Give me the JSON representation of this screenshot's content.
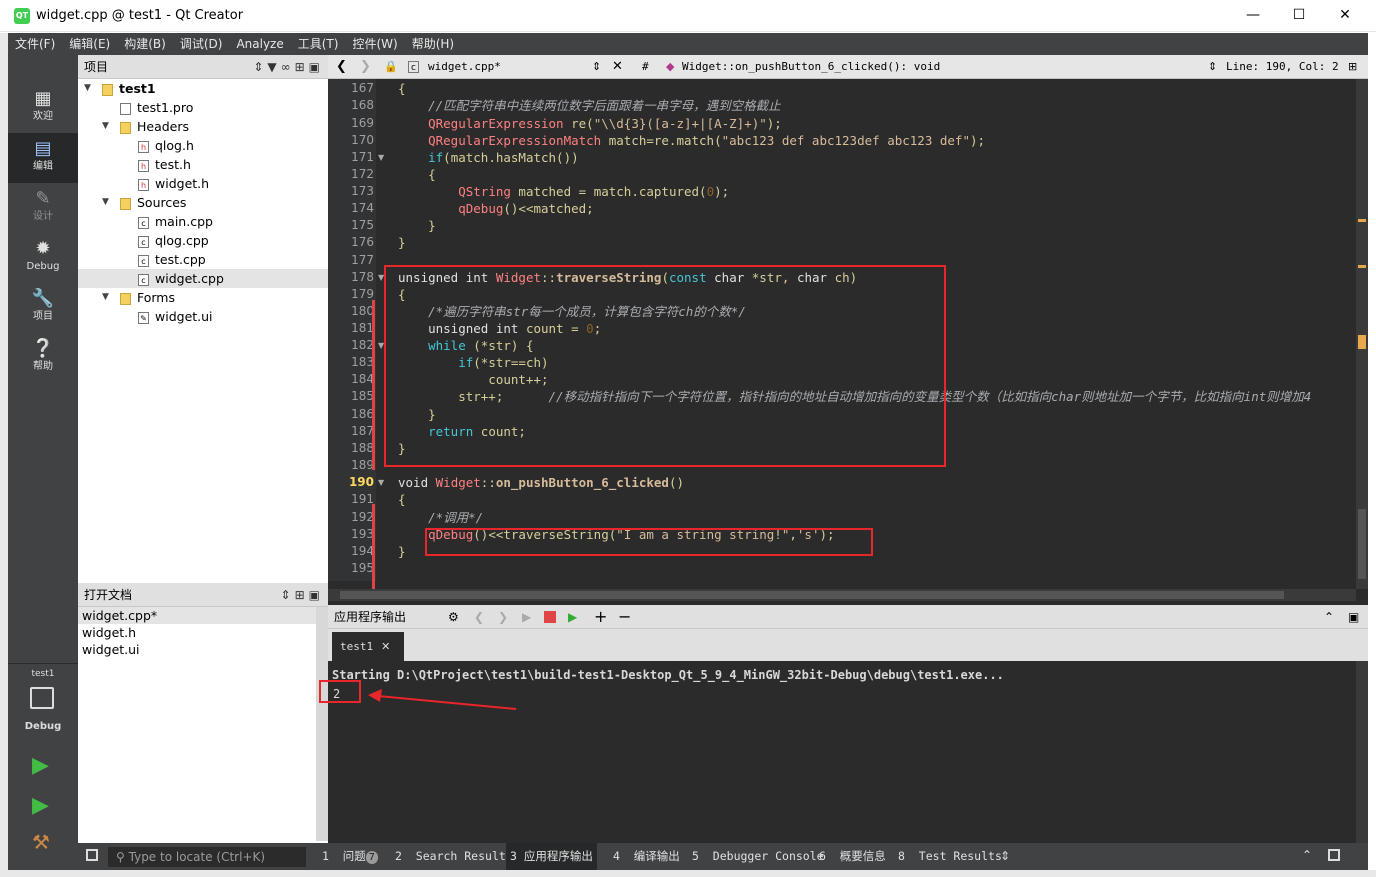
{
  "window": {
    "title": "widget.cpp @ test1 - Qt Creator",
    "app_icon": "qt-icon"
  },
  "menu": [
    "文件(F)",
    "编辑(E)",
    "构建(B)",
    "调试(D)",
    "Analyze",
    "工具(T)",
    "控件(W)",
    "帮助(H)"
  ],
  "modes": [
    {
      "label": "欢迎",
      "icon": "grid-icon"
    },
    {
      "label": "编辑",
      "icon": "edit-icon"
    },
    {
      "label": "设计",
      "icon": "pencil-icon"
    },
    {
      "label": "Debug",
      "icon": "bug-icon"
    },
    {
      "label": "项目",
      "icon": "wrench-icon"
    },
    {
      "label": "帮助",
      "icon": "help-icon"
    }
  ],
  "kit": {
    "project": "test1",
    "mode": "Debug"
  },
  "project_panel": {
    "title": "项目",
    "tree": {
      "root": "test1",
      "pro": "test1.pro",
      "headers": "Headers",
      "header_files": [
        "qlog.h",
        "test.h",
        "widget.h"
      ],
      "sources": "Sources",
      "source_files": [
        "main.cpp",
        "qlog.cpp",
        "test.cpp",
        "widget.cpp"
      ],
      "forms": "Forms",
      "form_files": [
        "widget.ui"
      ]
    }
  },
  "open_docs": {
    "title": "打开文档",
    "files": [
      "widget.cpp*",
      "widget.h",
      "widget.ui"
    ]
  },
  "editor": {
    "file": "widget.cpp*",
    "hash": "#",
    "symbol": "Widget::on_pushButton_6_clicked(): void",
    "position": "Line: 190, Col: 2",
    "line_numbers": [
      "167",
      "168",
      "169",
      "170",
      "171",
      "172",
      "173",
      "174",
      "175",
      "176",
      "177",
      "178",
      "179",
      "180",
      "181",
      "182",
      "183",
      "184",
      "185",
      "186",
      "187",
      "188",
      "189",
      "190",
      "191",
      "192",
      "193",
      "194",
      "195"
    ]
  },
  "output": {
    "title": "应用程序输出",
    "tab": "test1",
    "lines": [
      "Starting D:\\QtProject\\test1\\build-test1-Desktop_Qt_5_9_4_MinGW_32bit-Debug\\debug\\test1.exe...",
      "2"
    ]
  },
  "statusbar": {
    "locator_placeholder": "Type to locate (Ctrl+K)",
    "panes": [
      {
        "num": "1",
        "label": "问题",
        "badge": "7"
      },
      {
        "num": "2",
        "label": "Search Results"
      },
      {
        "num": "3",
        "label": "应用程序输出"
      },
      {
        "num": "4",
        "label": "编译输出"
      },
      {
        "num": "5",
        "label": "Debugger Console"
      },
      {
        "num": "6",
        "label": "概要信息"
      },
      {
        "num": "8",
        "label": "Test Results"
      }
    ]
  },
  "colors": {
    "highlight": "#e8262b",
    "editor_bg": "#2b2b2b",
    "sidebar_bg": "#404244"
  }
}
